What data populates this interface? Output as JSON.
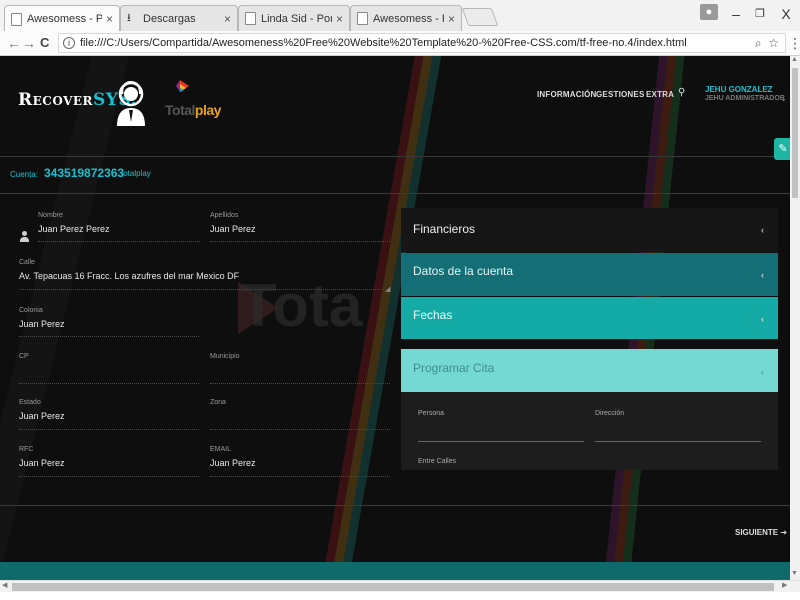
{
  "browser": {
    "tabs": [
      {
        "label": "Awesomess - Portfolio B"
      },
      {
        "label": "Descargas"
      },
      {
        "label": "Linda Sid - Portafolio"
      },
      {
        "label": "Awesomess - Portfolio B"
      }
    ],
    "tab_close": "×",
    "url": "file:///C:/Users/Compartida/Awesomeness%20Free%20Website%20Template%20-%20Free-CSS.com/tf-free-no.4/index.html",
    "window": {
      "minimize": "–",
      "maximize": "❐",
      "close": "X"
    },
    "nav": {
      "back": "←",
      "forward": "→",
      "reload": "C"
    }
  },
  "header": {
    "brand_primary": "Recover",
    "brand_accent": "SYS.",
    "partner_logo_text_a": "Total",
    "partner_logo_text_b": "play",
    "menu": [
      "INFORMACIÓN",
      "GESTIONES",
      "EXTRA"
    ],
    "user": {
      "name": "JEHU GONZALEZ",
      "role": "JEHU ADMINISTRADOR"
    }
  },
  "account": {
    "label": "Cuenta:",
    "number": "343519872363",
    "provider": "totalplay"
  },
  "form": {
    "nombre": {
      "label": "Nombre",
      "value": "Juan Perez Perez"
    },
    "apellidos": {
      "label": "Apellidos",
      "value": "Juan Perez"
    },
    "calle": {
      "label": "Calle",
      "value": "Av. Tepacuas 16 Fracc. Los azufres del mar Mexico DF"
    },
    "colonia": {
      "label": "Colonia",
      "value": "Juan Perez"
    },
    "cp": {
      "label": "CP",
      "value": ""
    },
    "municipio": {
      "label": "Municipio",
      "value": ""
    },
    "estado": {
      "label": "Estado",
      "value": "Juan Perez"
    },
    "zona": {
      "label": "Zona",
      "value": ""
    },
    "rfc": {
      "label": "RFC",
      "value": "Juan Perez"
    },
    "email": {
      "label": "EMAIL",
      "value": "Juan Perez"
    }
  },
  "accordion": {
    "items": [
      {
        "title": "Financieros"
      },
      {
        "title": "Datos de la cuenta"
      },
      {
        "title": "Fechas"
      },
      {
        "title": "Programar Cita"
      }
    ],
    "chevron": "‹",
    "panel": {
      "persona_label": "Persona",
      "direccion_label": "Dirección",
      "entre_calles_label": "Entre Calles"
    }
  },
  "footer": {
    "next_label": "SIGUIENTE"
  },
  "colors": {
    "accent": "#19c1d0",
    "teal_dark": "#136e75",
    "teal": "#14aaa5",
    "teal_light": "#74d8d3"
  }
}
